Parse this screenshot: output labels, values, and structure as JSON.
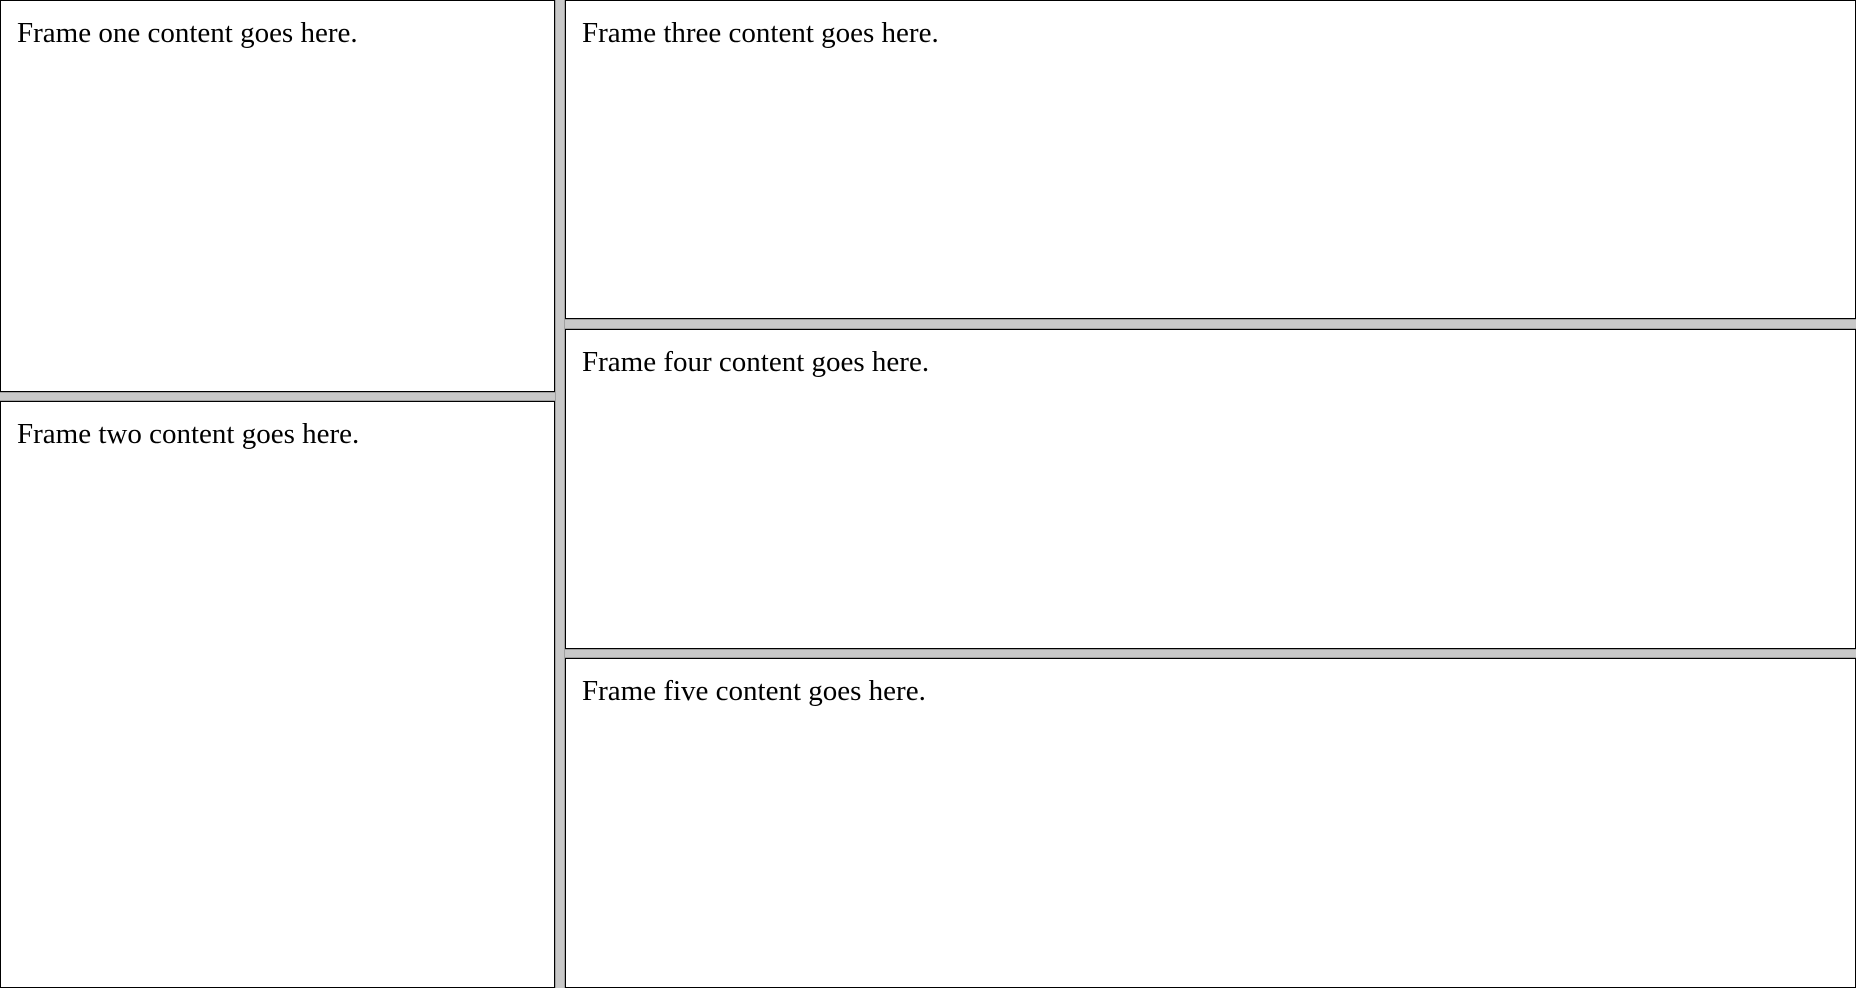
{
  "frames": {
    "one": {
      "content": "Frame one content goes here."
    },
    "two": {
      "content": "Frame two content goes here."
    },
    "three": {
      "content": "Frame three content goes here."
    },
    "four": {
      "content": "Frame four content goes here."
    },
    "five": {
      "content": "Frame five content goes here."
    }
  },
  "colors": {
    "background": "#ffffff",
    "frame_border": "#000000",
    "splitter": "#c8c8c8",
    "text": "#000000"
  }
}
